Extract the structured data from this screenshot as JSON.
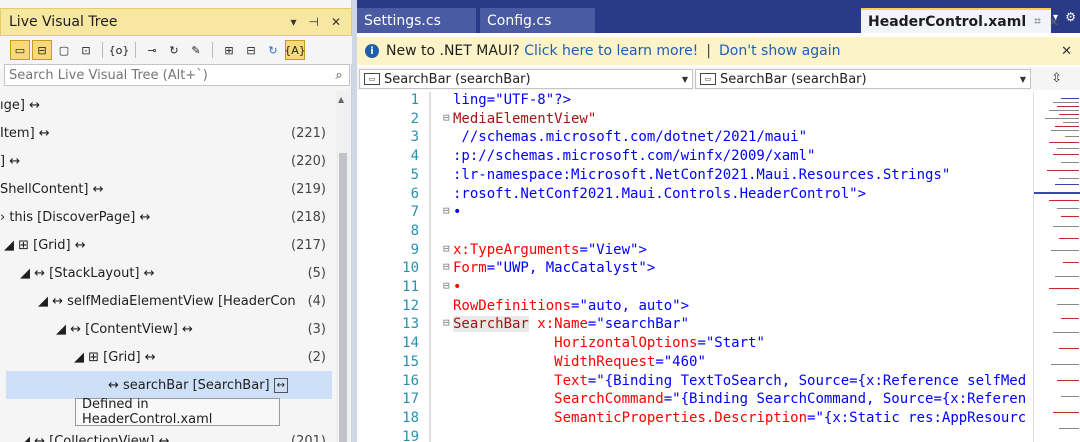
{
  "left_pane": {
    "title": "Live Visual Tree",
    "title_controls": [
      "▾",
      "⊣",
      "✕"
    ],
    "toolbar": [
      "▭",
      "⊟",
      "▢",
      "⊡",
      "{o}",
      "⊸",
      "↻",
      "✎",
      "⊞",
      "⊟",
      "↻",
      "{A}"
    ],
    "search_placeholder": "Search Live Visual Tree (Alt+`)",
    "tree_rows": [
      {
        "label": "ıge]  ↔",
        "count": ""
      },
      {
        "label": "Item]  ↔",
        "count": "(221)"
      },
      {
        "label": "]  ↔",
        "count": "(220)"
      },
      {
        "label": "ShellContent]  ↔",
        "count": "(219)"
      },
      {
        "label": "› this [DiscoverPage]  ↔",
        "count": "(218)"
      },
      {
        "label": "◢  ⊞  [Grid]  ↔",
        "count": "(217)"
      },
      {
        "label": "◢  ↔  [StackLayout]  ↔",
        "count": "(5)"
      },
      {
        "label": "◢  ↔  selfMediaElementView [HeaderContrc",
        "count": "(4)"
      },
      {
        "label": "◢  ↔  [ContentView]  ↔",
        "count": "(3)"
      },
      {
        "label": "◢  ⊞  [Grid]  ↔",
        "count": "(2)"
      },
      {
        "label": "↔  searchBar [SearchBar]",
        "count": ""
      },
      {
        "label": "",
        "count": ""
      },
      {
        "label": "◢  ↔  [CollectionView]  ↔",
        "count": "(201)"
      }
    ],
    "tooltip": "Defined in HeaderControl.xaml"
  },
  "editor": {
    "tabs": [
      "Settings.cs",
      "Config.cs",
      "HeaderControl.xaml"
    ],
    "active_tab_icons": [
      "⌗",
      "✕"
    ],
    "infobar": {
      "icon": "i",
      "text": "New to .NET MAUI?",
      "link1": "Click here to learn more!",
      "separator": "|",
      "link2": "Don't show again",
      "close": "✕"
    },
    "nav_left": "SearchBar (searchBar)",
    "nav_right": "SearchBar (searchBar)",
    "lines": [
      {
        "n": "1",
        "fold": "",
        "parts": [
          [
            "c-blue",
            "ling=\"UTF-8\"?>"
          ]
        ]
      },
      {
        "n": "2",
        "fold": "⊟",
        "parts": [
          [
            "c-maroon",
            "MediaElementView\""
          ]
        ]
      },
      {
        "n": "3",
        "fold": "",
        "parts": [
          [
            "c-blue",
            " //schemas.microsoft.com/dotnet/2021/maui\""
          ]
        ]
      },
      {
        "n": "4",
        "fold": "",
        "parts": [
          [
            "c-blue",
            ":p://schemas.microsoft.com/winfx/2009/xaml\""
          ]
        ]
      },
      {
        "n": "5",
        "fold": "",
        "parts": [
          [
            "c-blue",
            ":lr-namespace:Microsoft.NetConf2021.Maui.Resources.Strings\""
          ]
        ]
      },
      {
        "n": "6",
        "fold": "",
        "parts": [
          [
            "c-blue",
            ":rosoft.NetConf2021.Maui.Controls.HeaderControl\">"
          ]
        ]
      },
      {
        "n": "7",
        "fold": "⊟",
        "parts": [
          [
            "c-blue",
            "•"
          ]
        ]
      },
      {
        "n": "8",
        "fold": "",
        "parts": [
          [
            "",
            ""
          ]
        ]
      },
      {
        "n": "9",
        "fold": "⊟",
        "parts": [
          [
            "c-red",
            "x:TypeArguments"
          ],
          [
            "c-blue",
            "=\"View\">"
          ]
        ]
      },
      {
        "n": "10",
        "fold": "⊟",
        "parts": [
          [
            "c-red",
            "Form"
          ],
          [
            "c-blue",
            "=\"UWP, MacCatalyst\">"
          ]
        ]
      },
      {
        "n": "11",
        "fold": "⊟",
        "parts": [
          [
            "c-red",
            "•"
          ]
        ]
      },
      {
        "n": "12",
        "fold": "",
        "parts": [
          [
            "c-red",
            "RowDefinitions"
          ],
          [
            "c-blue",
            "=\"auto, auto\">"
          ]
        ]
      },
      {
        "n": "13",
        "fold": "⊟",
        "parts": [
          [
            "c-maroon c-hl",
            "SearchBar"
          ],
          [
            "",
            " "
          ],
          [
            "c-red",
            "x:Name"
          ],
          [
            "c-blue",
            "=\"searchBar\""
          ]
        ]
      },
      {
        "n": "14",
        "fold": "",
        "parts": [
          [
            "",
            "            "
          ],
          [
            "c-red",
            "HorizontalOptions"
          ],
          [
            "c-blue",
            "=\"Start\""
          ]
        ]
      },
      {
        "n": "15",
        "fold": "",
        "parts": [
          [
            "",
            "            "
          ],
          [
            "c-red",
            "WidthRequest"
          ],
          [
            "c-blue",
            "=\"460\""
          ]
        ]
      },
      {
        "n": "16",
        "fold": "",
        "parts": [
          [
            "",
            "            "
          ],
          [
            "c-red",
            "Text"
          ],
          [
            "c-blue",
            "=\"{Binding TextToSearch, Source={x:Reference selfMed"
          ]
        ]
      },
      {
        "n": "17",
        "fold": "",
        "parts": [
          [
            "",
            "            "
          ],
          [
            "c-red",
            "SearchCommand"
          ],
          [
            "c-blue",
            "=\"{Binding SearchCommand, Source={x:Referen"
          ]
        ]
      },
      {
        "n": "18",
        "fold": "",
        "parts": [
          [
            "",
            "            "
          ],
          [
            "c-red",
            "SemanticProperties.Description"
          ],
          [
            "c-blue",
            "=\"{x:Static res:AppResourc"
          ]
        ]
      },
      {
        "n": "19",
        "fold": "",
        "parts": [
          [
            "",
            ""
          ]
        ]
      }
    ]
  },
  "colors": {
    "accent_tab_bar": "#2b3a87",
    "info_bar": "#fcf3c9",
    "line_number": "#2b91af"
  }
}
